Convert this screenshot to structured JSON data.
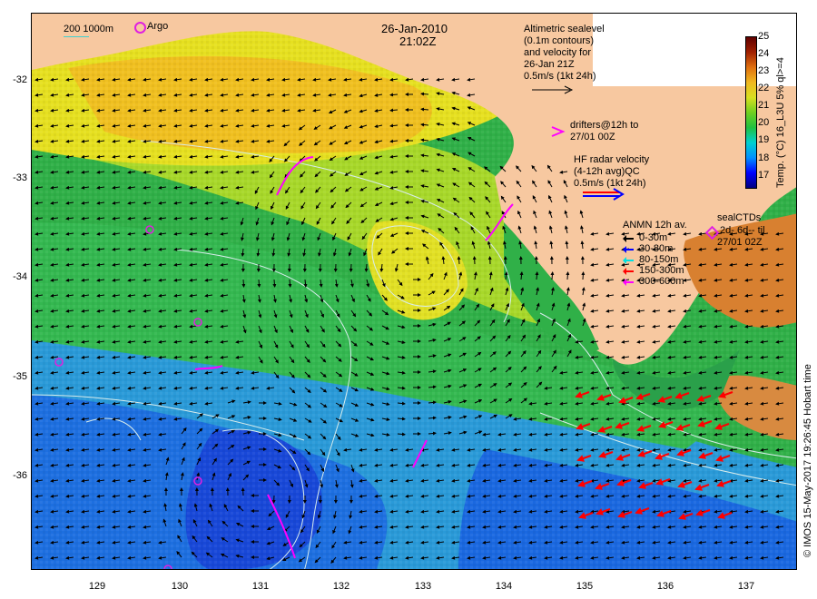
{
  "title": {
    "date": "26-Jan-2010",
    "time": "21:02Z"
  },
  "legend_top_left": {
    "scale_text": "200  1000m",
    "argo_label": "Argo"
  },
  "altimetric_note": [
    "Altimetric sealevel",
    "(0.1m contours)",
    "and velocity for",
    "26-Jan 21Z",
    "0.5m/s (1kt 24h)"
  ],
  "drifters_note": [
    "drifters@12h to",
    "27/01 00Z"
  ],
  "hf_radar_note": [
    "HF radar velocity",
    "(4-12h avg)QC",
    "0.5m/s (1kt 24h)"
  ],
  "anmn_legend": {
    "title": "ANMN 12h av.",
    "items": [
      {
        "label": "0-30m",
        "color": "#000000"
      },
      {
        "label": "30-80m",
        "color": "#0000ff"
      },
      {
        "label": "80-150m",
        "color": "#00e0e0"
      },
      {
        "label": "150-300m",
        "color": "#ff0000"
      },
      {
        "label": "300-600m",
        "color": "#ff00ff"
      }
    ]
  },
  "seal_ctds": [
    "sealCTDs",
    "2d- 6d-- til",
    "27/01 02Z"
  ],
  "colorbar": {
    "label": "Temp. (°C) 16_L3U 5% ql>=4",
    "ticks": [
      "25",
      "24",
      "23",
      "22",
      "21",
      "20",
      "19",
      "18",
      "17"
    ],
    "min": 16.3,
    "max": 25,
    "colors": [
      "#000080",
      "#0000ff",
      "#0090ff",
      "#00d0d0",
      "#20c040",
      "#70d020",
      "#d8e020",
      "#f0b820",
      "#e07010",
      "#a02000",
      "#600000"
    ]
  },
  "axes": {
    "lat_ticks": [
      "-32",
      "-33",
      "-34",
      "-35",
      "-36"
    ],
    "lon_ticks": [
      "129",
      "130",
      "131",
      "132",
      "133",
      "134",
      "135",
      "136",
      "137"
    ]
  },
  "credit": "© IMOS 15-May-2017 19:26:45 Hobart time",
  "colors": {
    "land": "#f7c8a0",
    "arrow": "#000000",
    "contour": "#d0e8e8",
    "drifter": "#ff00ff",
    "hf_red": "#ff0000",
    "hf_blue": "#0000ff"
  }
}
